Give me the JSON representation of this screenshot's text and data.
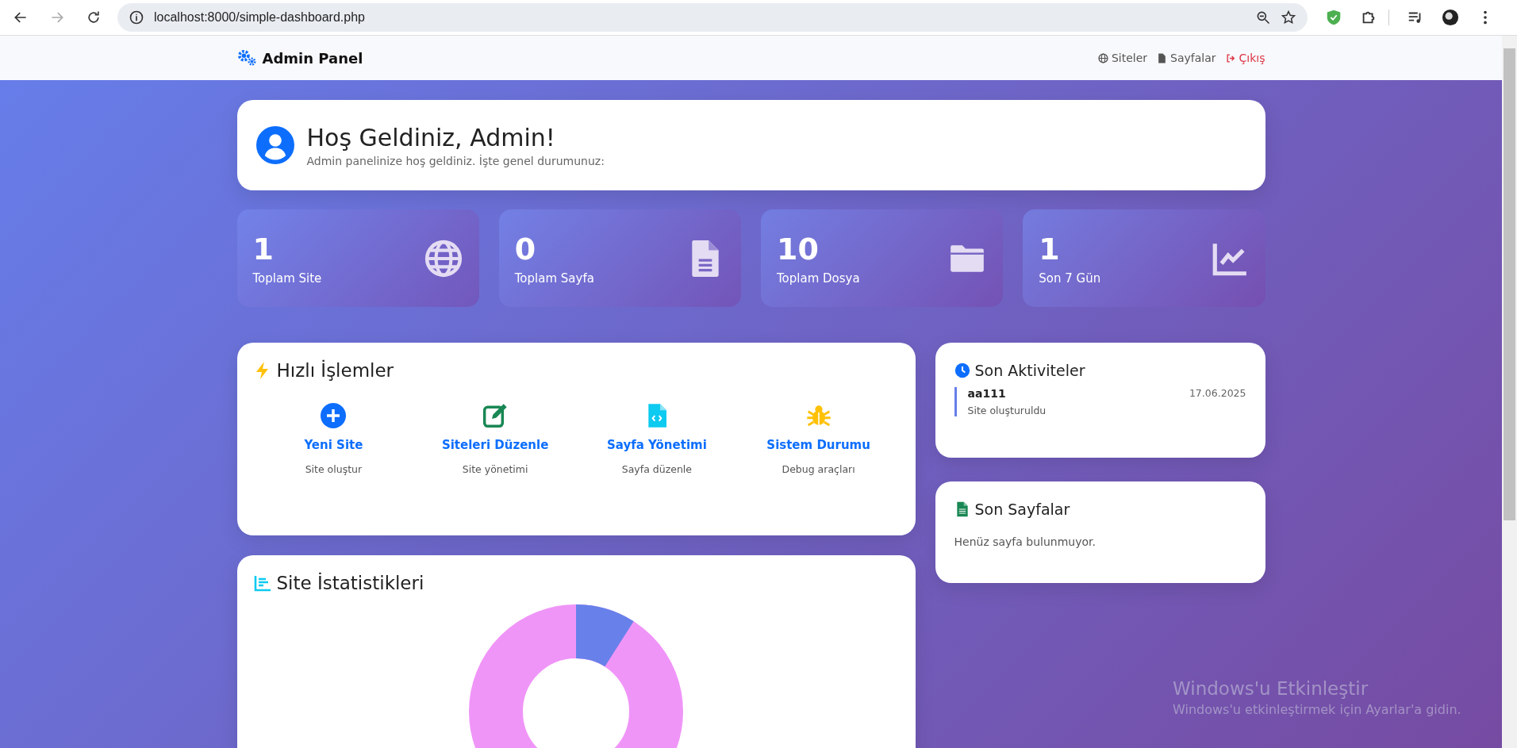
{
  "browser": {
    "url": "localhost:8000/simple-dashboard.php",
    "back_disabled": false,
    "forward_disabled": true
  },
  "navbar": {
    "brand": "Admin Panel",
    "links": [
      {
        "kind": "globe",
        "label": "Siteler"
      },
      {
        "kind": "file",
        "label": "Sayfalar"
      },
      {
        "kind": "logout",
        "label": "Çıkış"
      }
    ]
  },
  "welcome": {
    "title": "Hoş Geldiniz, Admin!",
    "subtitle": "Admin panelinize hoş geldiniz. İşte genel durumunuz:"
  },
  "stats": [
    {
      "kind": "globe",
      "value": "1",
      "label": "Toplam Site"
    },
    {
      "kind": "file",
      "value": "0",
      "label": "Toplam Sayfa"
    },
    {
      "kind": "folder",
      "value": "10",
      "label": "Toplam Dosya"
    },
    {
      "kind": "chart",
      "value": "1",
      "label": "Son 7 Gün"
    }
  ],
  "quick_actions": {
    "title": "Hızlı İşlemler",
    "items": [
      {
        "kind": "plus",
        "title": "Yeni Site",
        "subtitle": "Site oluştur"
      },
      {
        "kind": "edit",
        "title": "Siteleri Düzenle",
        "subtitle": "Site yönetimi"
      },
      {
        "kind": "code",
        "title": "Sayfa Yönetimi",
        "subtitle": "Sayfa düzenle"
      },
      {
        "kind": "bug",
        "title": "Sistem Durumu",
        "subtitle": "Debug araçları"
      }
    ]
  },
  "site_stats": {
    "title": "Site İstatistikleri"
  },
  "recent_activities": {
    "title": "Son Aktiviteler",
    "items": [
      {
        "name": "aa111",
        "description": "Site oluşturuldu",
        "date": "17.06.2025"
      }
    ]
  },
  "recent_pages": {
    "title": "Son Sayfalar",
    "empty_text": "Henüz sayfa bulunmuyor."
  },
  "os_overlay": {
    "title": "Windows'u Etkinleştir",
    "text": "Windows'u etkinleştirmek için Ayarlar'a gidin."
  }
}
